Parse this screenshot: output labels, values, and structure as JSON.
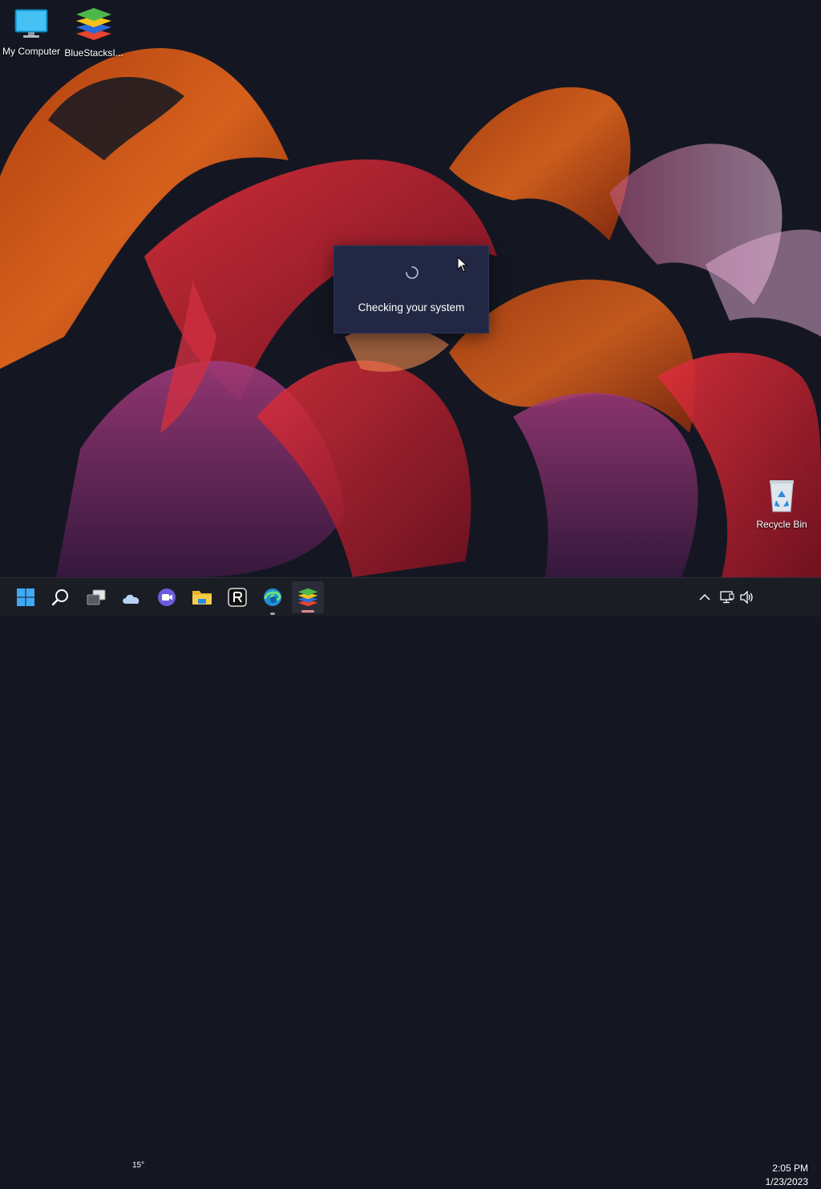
{
  "desktop": {
    "icons": [
      {
        "label": "My Computer",
        "icon": "monitor-icon"
      },
      {
        "label": "BlueStacksI...",
        "icon": "bluestacks-icon"
      },
      {
        "label": "Recycle Bin",
        "icon": "recycle-bin-icon"
      }
    ]
  },
  "dialog": {
    "message": "Checking your system",
    "icon": "loading-spinner-icon"
  },
  "taskbar": {
    "buttons": [
      {
        "name": "start",
        "icon": "windows-logo-icon"
      },
      {
        "name": "search",
        "icon": "search-icon"
      },
      {
        "name": "task-view",
        "icon": "task-view-icon"
      },
      {
        "name": "widgets",
        "icon": "weather-cloud-icon"
      },
      {
        "name": "chat",
        "icon": "video-camera-icon"
      },
      {
        "name": "file-explorer",
        "icon": "folder-icon"
      },
      {
        "name": "app-r",
        "icon": "r-app-icon"
      },
      {
        "name": "edge",
        "icon": "edge-browser-icon"
      },
      {
        "name": "bluestacks",
        "icon": "bluestacks-icon"
      }
    ],
    "weather_temp": "15°",
    "tray": {
      "icons": [
        "chevron-up-icon",
        "network-icon",
        "speaker-icon"
      ],
      "time": "2:05 PM",
      "date": "1/23/2023"
    }
  }
}
